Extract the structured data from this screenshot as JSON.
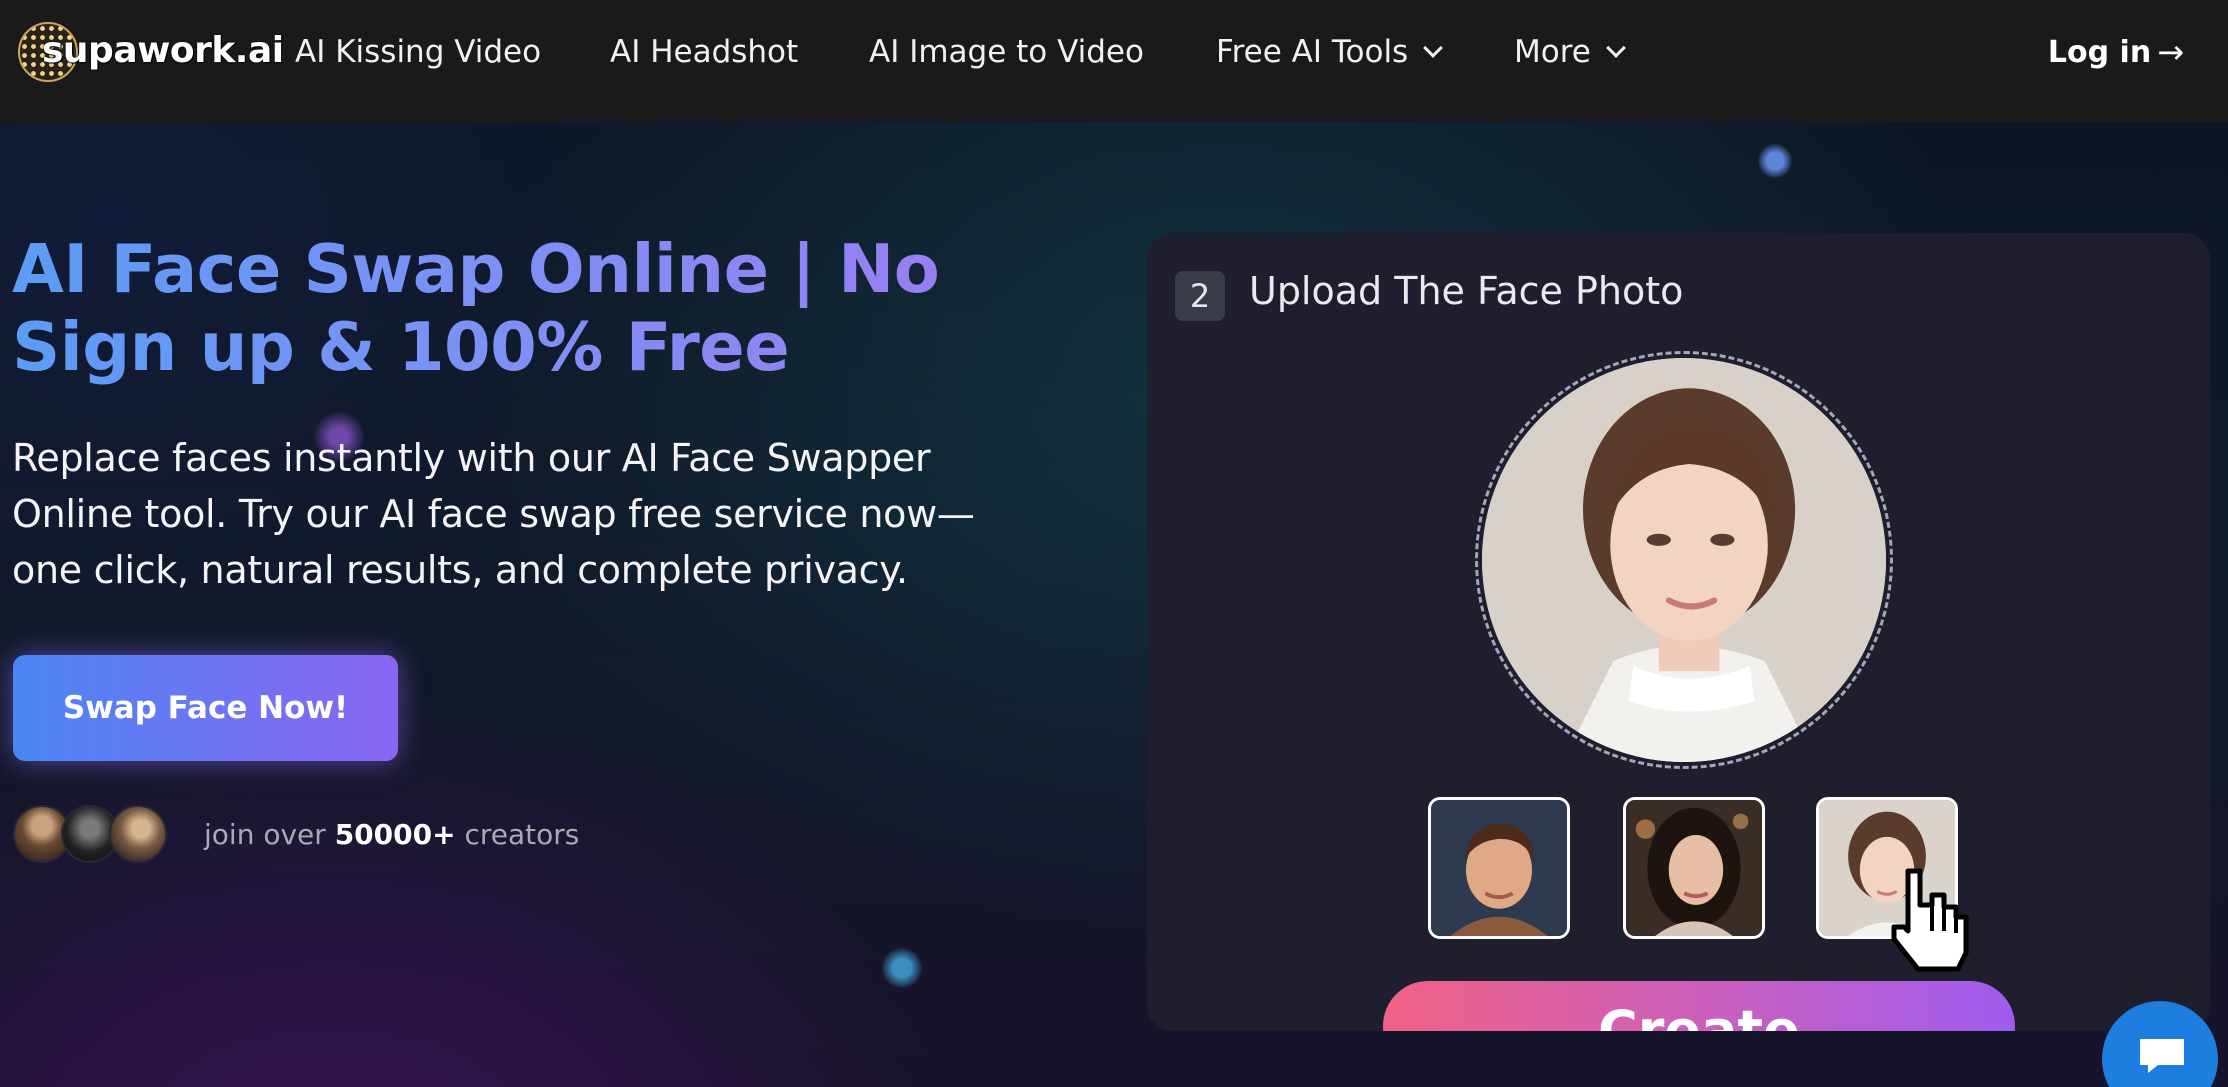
{
  "nav": {
    "logo_text": "supawork.ai",
    "items": [
      {
        "label": "AI Kissing Video"
      },
      {
        "label": "AI Headshot"
      },
      {
        "label": "AI Image to Video"
      },
      {
        "label": "Free AI Tools"
      },
      {
        "label": "More"
      }
    ],
    "login": "Log in",
    "login_arrow": "→"
  },
  "hero": {
    "title_line1": "AI Face Swap Online | No",
    "title_line2": "Sign up & 100% Free",
    "subtitle_line1": "Replace faces instantly with our AI Face Swapper",
    "subtitle_line2": "Online tool. Try our AI face swap free service now—",
    "subtitle_line3": "one click, natural results, and complete privacy.",
    "cta": "Swap Face Now!",
    "join_prefix": "join over",
    "join_count": "50000+",
    "join_suffix": "creators"
  },
  "card": {
    "step_number": "2",
    "title": "Upload The Face Photo",
    "create_label": "Create"
  },
  "colors": {
    "accent_blue": "#4c86f4",
    "accent_purple": "#8a66f2",
    "create_pink": "#f06284",
    "chat_blue": "#1d7ee0"
  },
  "icons": [
    "logo-mark-icon",
    "chevron-down-icon",
    "pointer-hand-cursor-icon",
    "chat-bubble-icon"
  ]
}
